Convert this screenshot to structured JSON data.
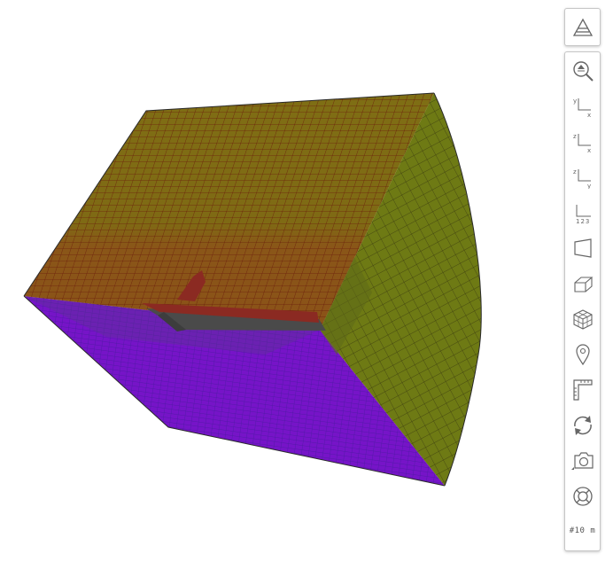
{
  "toolbar": {
    "top_button": {
      "icon": "layers-icon"
    },
    "tools": [
      {
        "icon": "zoom-extents-icon"
      },
      {
        "icon": "view-xy-icon",
        "axis_top": "y",
        "axis_right": "x"
      },
      {
        "icon": "view-xz-icon",
        "axis_top": "z",
        "axis_right": "x"
      },
      {
        "icon": "view-yz-icon",
        "axis_top": "z",
        "axis_right": "y"
      },
      {
        "icon": "view-123-icon",
        "label": "123"
      },
      {
        "icon": "perspective-icon"
      },
      {
        "icon": "box-view-icon"
      },
      {
        "icon": "cube-mesh-icon"
      },
      {
        "icon": "location-pin-icon"
      },
      {
        "icon": "ruler-icon"
      },
      {
        "icon": "rotate-icon"
      },
      {
        "icon": "camera-icon"
      },
      {
        "icon": "lifebuoy-icon"
      }
    ],
    "grid_scale_label": "#10 m"
  },
  "scene": {
    "colors": {
      "top_face": "#7d6a14",
      "top_face_band": "#8a5418",
      "side_face": "#6e7a14",
      "bottom_face": "#7614c8",
      "mesh_line": "#7a1a10",
      "structure": "#8b2a22",
      "structure_dark": "#4a4a4a"
    }
  }
}
